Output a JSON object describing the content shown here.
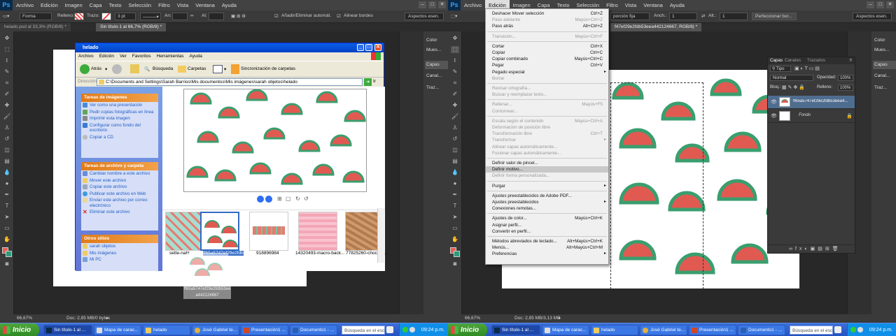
{
  "left": {
    "menu": [
      "Archivo",
      "Edición",
      "Imagen",
      "Capa",
      "Texto",
      "Selección",
      "Filtro",
      "Vista",
      "Ventana",
      "Ayuda"
    ],
    "options": {
      "mode": "Forma",
      "fill_label": "Relleno:",
      "stroke_label": "Trazo:",
      "stroke_size": "3 pt",
      "w_label": "An:",
      "h_label": "Al:",
      "auto_add": "Añadir/Eliminar automát.",
      "align_edges": "Alinear bordes",
      "workspace": "Aspectos esen."
    },
    "tabs": [
      "helado.psd al 33,3% (RGB/8) *",
      "Sin título-1 al 66,7% (RGB/8) *"
    ],
    "dock": {
      "color": "Color",
      "samples": "Mues...",
      "layers": "Capas",
      "channels": "Canal...",
      "paths": "Traz..."
    },
    "status": {
      "zoom": "66,67%",
      "doc": "Doc: 2,85 MB/0 bytes"
    },
    "explorer": {
      "title": "helado",
      "menu": [
        "Archivo",
        "Edición",
        "Ver",
        "Favoritos",
        "Herramientas",
        "Ayuda"
      ],
      "toolbar": {
        "back": "Atrás",
        "search": "Búsqueda",
        "folders": "Carpetas",
        "sync": "Sincronización de carpetas"
      },
      "address_label": "Dirección",
      "address": "C:\\Documents and Settings\\Sarah Barrios\\Mis documentos\\Mis imágenes\\sarah objetos\\helado",
      "go": "Ir",
      "image_tasks": {
        "title": "Tareas de imágenes",
        "items": [
          "Ver como una presentación",
          "Pedir copias fotográficas en línea",
          "Imprimir esta imagen",
          "Configurar como fondo del escritorio",
          "Copiar a CD"
        ]
      },
      "file_tasks": {
        "title": "Tareas de archivo y carpeta",
        "items": [
          "Cambiar nombre a este archivo",
          "Mover este archivo",
          "Copiar este archivo",
          "Publicar este archivo en Web",
          "Enviar este archivo por correo electrónico",
          "Eliminar este archivo"
        ]
      },
      "other_places": {
        "title": "Otros sitios",
        "items": [
          "sarah objetos",
          "Mis imágenes",
          "Mi PC"
        ]
      },
      "thumbs": [
        "sette-nahl",
        "ff65a5747ef29e2fdb53eea442124667",
        "918896984",
        "14320493-macro-back...",
        "77825260-chocolat..."
      ],
      "drag_label": "ff65a5747ef29e2fdb53eea442124667"
    },
    "taskbar": {
      "start": "Inicio",
      "buttons": [
        "Sin título-1 al ...",
        "Mapa de carac...",
        "helado",
        "José Gabriel te...",
        "Presentación1 ...",
        "Documento1 - ..."
      ],
      "search": "Búsqueda en el escrito",
      "clock": "09:24 p.m."
    }
  },
  "right": {
    "menu": [
      "Archivo",
      "Edición",
      "Imagen",
      "Capa",
      "Texto",
      "Selección",
      "Filtro",
      "Vista",
      "Ventana",
      "Ayuda"
    ],
    "options": {
      "proportion": "porción fija",
      "w_label": "Anch.:",
      "w_val": "1",
      "h_label": "Alt.:",
      "h_val": "1",
      "refine": "Perfeccionar bor...",
      "workspace": "Aspectos esen."
    },
    "tab": "f47ef29e2fdb53eea442124667, RGB/8) *",
    "dock": {
      "color": "Color",
      "samples": "Mues...",
      "layers": "Capas",
      "channels": "Canal...",
      "paths": "Traz..."
    },
    "edit_menu": [
      {
        "label": "Deshacer Mover selección",
        "shortcut": "Ctrl+Z",
        "state": "normal"
      },
      {
        "label": "Paso adelante",
        "shortcut": "Mayús+Ctrl+Z",
        "state": "disabled"
      },
      {
        "label": "Paso atrás",
        "shortcut": "Alt+Ctrl+Z",
        "state": "normal"
      },
      {
        "sep": true
      },
      {
        "label": "Transición...",
        "shortcut": "Mayús+Ctrl+F",
        "state": "disabled"
      },
      {
        "sep": true
      },
      {
        "label": "Cortar",
        "shortcut": "Ctrl+X",
        "state": "normal"
      },
      {
        "label": "Copiar",
        "shortcut": "Ctrl+C",
        "state": "normal"
      },
      {
        "label": "Copiar combinado",
        "shortcut": "Mayús+Ctrl+C",
        "state": "normal"
      },
      {
        "label": "Pegar",
        "shortcut": "Ctrl+V",
        "state": "normal"
      },
      {
        "label": "Pegado especial",
        "shortcut": "",
        "state": "normal",
        "submenu": true
      },
      {
        "label": "Borrar",
        "shortcut": "",
        "state": "disabled"
      },
      {
        "sep": true
      },
      {
        "label": "Revisar ortografía...",
        "shortcut": "",
        "state": "disabled"
      },
      {
        "label": "Buscar y reemplazar texto...",
        "shortcut": "",
        "state": "disabled"
      },
      {
        "sep": true
      },
      {
        "label": "Rellenar...",
        "shortcut": "Mayús+F5",
        "state": "disabled"
      },
      {
        "label": "Contornear...",
        "shortcut": "",
        "state": "disabled"
      },
      {
        "sep": true
      },
      {
        "label": "Escala según el contenido",
        "shortcut": "Mayús+Ctrl+A",
        "state": "disabled"
      },
      {
        "label": "Deformación de posición libre",
        "shortcut": "",
        "state": "disabled"
      },
      {
        "label": "Transformación libre",
        "shortcut": "Ctrl+T",
        "state": "disabled"
      },
      {
        "label": "Transformar",
        "shortcut": "",
        "state": "disabled",
        "submenu": true
      },
      {
        "label": "Alinear capas automáticamente...",
        "shortcut": "",
        "state": "disabled"
      },
      {
        "label": "Fusionar capas automáticamente...",
        "shortcut": "",
        "state": "disabled"
      },
      {
        "sep": true
      },
      {
        "label": "Definir valor de pincel...",
        "shortcut": "",
        "state": "normal"
      },
      {
        "label": "Definir motivo...",
        "shortcut": "",
        "state": "highlighted"
      },
      {
        "label": "Definir forma personalizada...",
        "shortcut": "",
        "state": "disabled"
      },
      {
        "sep": true
      },
      {
        "label": "Purgar",
        "shortcut": "",
        "state": "normal",
        "submenu": true
      },
      {
        "sep": true
      },
      {
        "label": "Ajustes preestablecidos de Adobe PDF...",
        "shortcut": "",
        "state": "normal"
      },
      {
        "label": "Ajustes preestablecidos",
        "shortcut": "",
        "state": "normal",
        "submenu": true
      },
      {
        "label": "Conexiones remotas...",
        "shortcut": "",
        "state": "normal"
      },
      {
        "sep": true
      },
      {
        "label": "Ajustes de color...",
        "shortcut": "Mayús+Ctrl+K",
        "state": "normal"
      },
      {
        "label": "Asignar perfil...",
        "shortcut": "",
        "state": "normal"
      },
      {
        "label": "Convertir en perfil...",
        "shortcut": "",
        "state": "normal"
      },
      {
        "sep": true
      },
      {
        "label": "Métodos abreviados de teclado...",
        "shortcut": "Alt+Mayús+Ctrl+K",
        "state": "normal"
      },
      {
        "label": "Menús...",
        "shortcut": "Alt+Mayús+Ctrl+M",
        "state": "normal"
      },
      {
        "label": "Preferencias",
        "shortcut": "",
        "state": "normal",
        "submenu": true
      }
    ],
    "layers_panel": {
      "tabs": [
        "Capas",
        "Canales",
        "Trazados"
      ],
      "kind": "Tipo",
      "blend": "Normal",
      "opacity_label": "Opacidad:",
      "opacity": "100%",
      "lock_label": "Bloq.:",
      "fill_label": "Relleno:",
      "fill": "100%",
      "layers": [
        "ff65a5747ef29e2fdb53eea4...",
        "Fondo"
      ]
    },
    "status": {
      "zoom": "66,67%",
      "doc": "Doc: 2,85 MB/3,13 MB"
    },
    "taskbar": {
      "start": "Inicio",
      "buttons": [
        "Sin título-1 al ...",
        "Mapa de carac...",
        "helado",
        "José Gabriel te...",
        "Presentación1 ...",
        "Documento1 - ..."
      ],
      "search": "Búsqueda en el escrito",
      "clock": "09:24 p.m."
    }
  },
  "colors": {
    "ps_bg": "#282828",
    "ps_panel": "#3a3a3a",
    "xp_blue": "#0a5de6",
    "melon_red": "#e15a52",
    "rind_green": "#3a9e6e",
    "fg_swatch": "#e8604a",
    "bg_swatch": "#2f9a7a"
  }
}
